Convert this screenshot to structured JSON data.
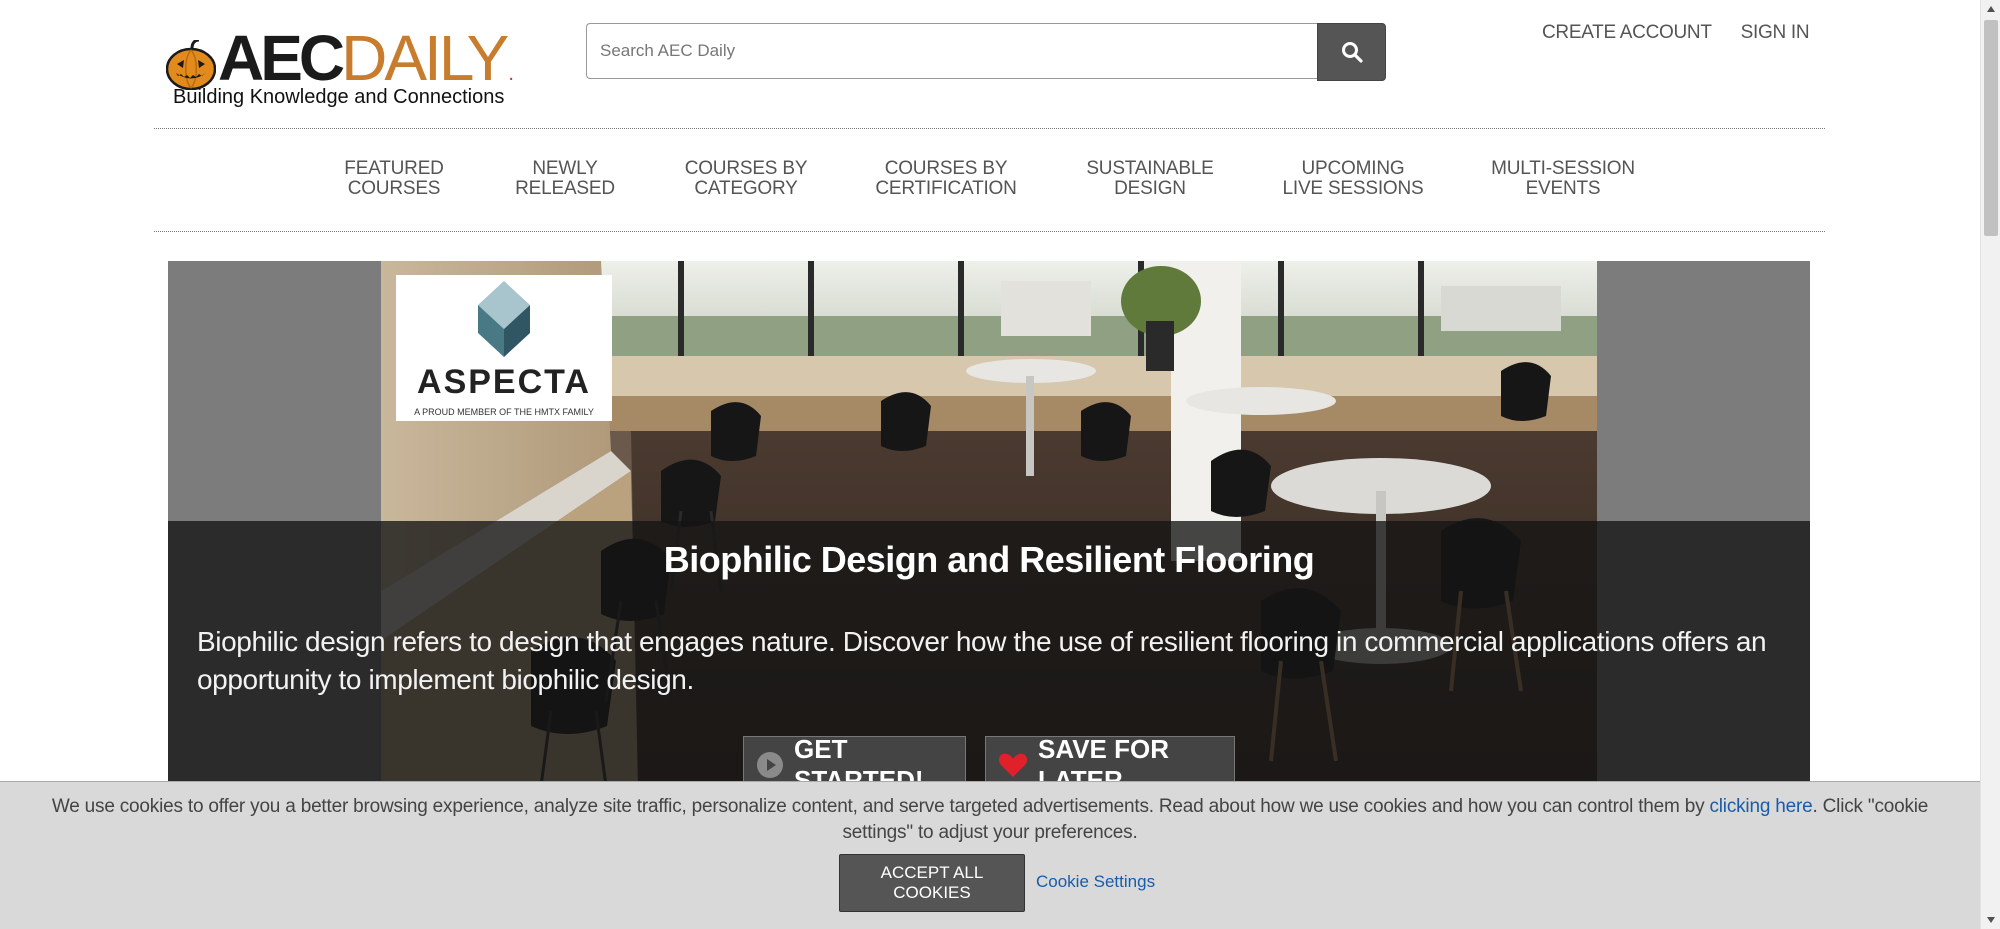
{
  "header": {
    "logo_aec": "AEC",
    "logo_daily": "DAILY",
    "tagline": "Building Knowledge and Connections",
    "search_placeholder": "Search AEC Daily",
    "create_account": "CREATE ACCOUNT",
    "sign_in": "SIGN IN"
  },
  "nav": {
    "items": [
      {
        "line1": "FEATURED",
        "line2": "COURSES"
      },
      {
        "line1": "NEWLY",
        "line2": "RELEASED"
      },
      {
        "line1": "COURSES BY",
        "line2": "CATEGORY"
      },
      {
        "line1": "COURSES BY",
        "line2": "CERTIFICATION"
      },
      {
        "line1": "SUSTAINABLE",
        "line2": "DESIGN"
      },
      {
        "line1": "UPCOMING",
        "line2": "LIVE SESSIONS"
      },
      {
        "line1": "MULTI-SESSION",
        "line2": "EVENTS"
      }
    ]
  },
  "hero": {
    "sponsor_name": "ASPECTA",
    "sponsor_tagline": "A PROUD MEMBER OF THE HMTX FAMILY",
    "title": "Biophilic Design and Resilient Flooring",
    "description": "Biophilic design refers to design that engages nature. Discover how the use of resilient flooring in commercial applications offers an opportunity to implement biophilic design.",
    "get_started": "GET STARTED!",
    "save_for_later": "SAVE FOR LATER"
  },
  "cookie": {
    "glyph": "",
    "text_before": "We use cookies to offer you a better browsing experience, analyze site traffic, personalize content, and serve targeted advertisements. Read about how we use cookies and how you can control them by",
    "link": "clicking here",
    "text_after": ". Click \"cookie settings\" to adjust your preferences.",
    "accept": "ACCEPT ALL COOKIES",
    "settings": "Cookie Settings"
  },
  "colors": {
    "brand_orange": "#c87d2e",
    "link_blue": "#1a5ca8",
    "hero_gray": "#7c7c7c",
    "heart_red": "#e0202a"
  }
}
